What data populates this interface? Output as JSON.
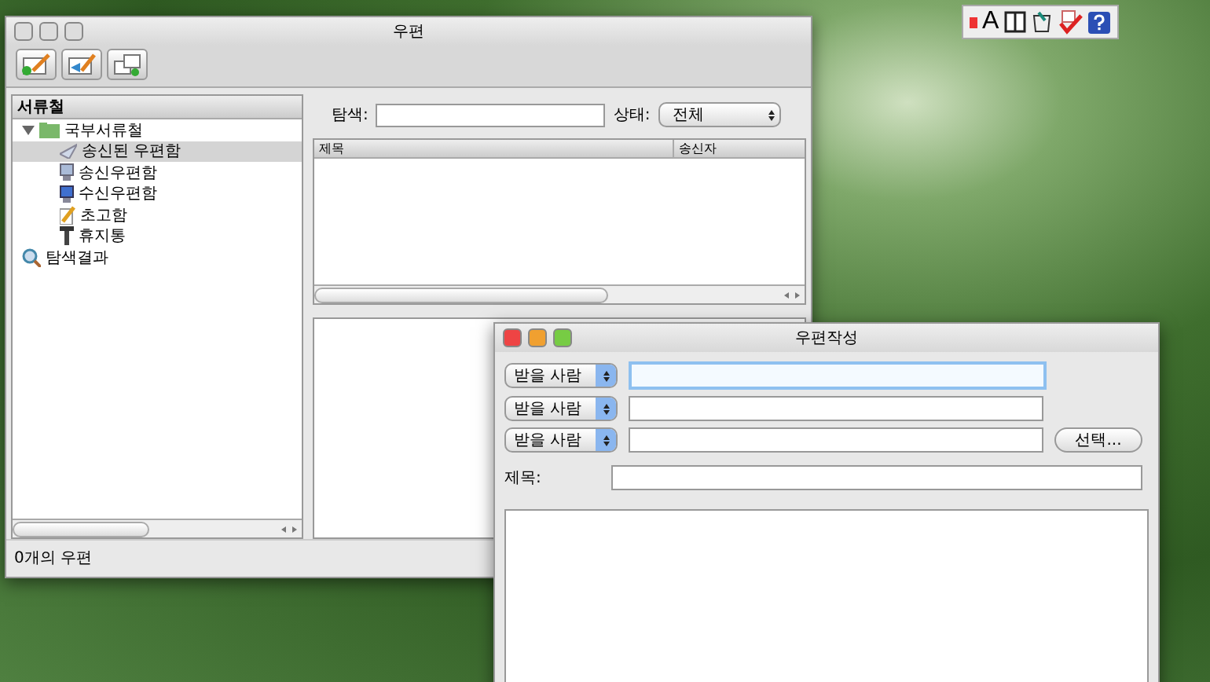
{
  "menu_extras": [
    {
      "kind": "dot"
    },
    {
      "kind": "letter",
      "label": "A"
    },
    {
      "kind": "panes"
    },
    {
      "kind": "cup"
    },
    {
      "kind": "check"
    },
    {
      "kind": "help"
    }
  ],
  "window": {
    "title": "우편",
    "toolbar": [
      {
        "kind": "compose"
      },
      {
        "kind": "reply"
      },
      {
        "kind": "sync"
      }
    ],
    "sidebar": {
      "header": "서류철",
      "items": [
        {
          "label": "국부서류철",
          "kind": "folder",
          "expanded": true,
          "selected": false,
          "children": [
            {
              "label": "송신된 우편함",
              "kind": "sent",
              "selected": true
            },
            {
              "label": "송신우편함",
              "kind": "outbox",
              "selected": false
            },
            {
              "label": "수신우편함",
              "kind": "inbox",
              "selected": false
            },
            {
              "label": "초고함",
              "kind": "draft",
              "selected": false
            },
            {
              "label": "휴지통",
              "kind": "trash",
              "selected": false
            }
          ]
        },
        {
          "label": "탐색결과",
          "kind": "search",
          "selected": false
        }
      ]
    },
    "search": {
      "label": "탐색:"
    },
    "filter": {
      "label": "상태:",
      "value": "전체"
    },
    "table": {
      "columns": [
        "제목",
        "송신자"
      ]
    },
    "status_bar": "0개의 우편"
  },
  "compose": {
    "title": "우편작성",
    "recipients": [
      {
        "type": "받을 사람",
        "focused": true
      },
      {
        "type": "받을 사람",
        "focused": false
      },
      {
        "type": "받을 사람",
        "focused": false
      }
    ],
    "select_button": "선택...",
    "subject_label": "제목:"
  }
}
